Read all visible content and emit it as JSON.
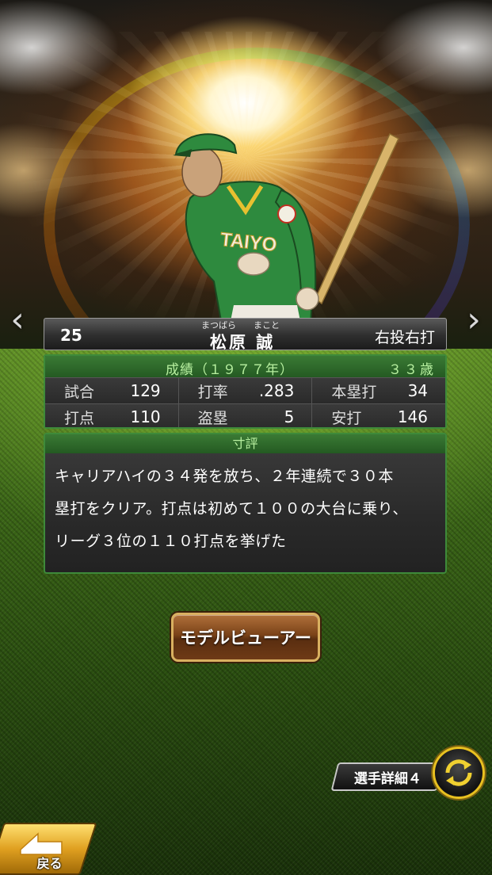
{
  "player": {
    "number": "25",
    "name": "松原 誠",
    "kana_family": "まつばら",
    "kana_given": "まこと",
    "throw_bat": "右投右打",
    "jersey_text": "TAIYO"
  },
  "stats": {
    "season_label": "成績（１９７７年）",
    "age_label": "３３歳",
    "rows": [
      [
        {
          "label": "試合",
          "value": "129"
        },
        {
          "label": "打率",
          "value": ".283"
        },
        {
          "label": "本塁打",
          "value": "34"
        }
      ],
      [
        {
          "label": "打点",
          "value": "110"
        },
        {
          "label": "盗塁",
          "value": "5"
        },
        {
          "label": "安打",
          "value": "146"
        }
      ]
    ]
  },
  "comment": {
    "title": "寸評",
    "text": "キャリアハイの３４発を放ち、２年連続で３０本\n塁打をクリア。打点は初めて１００の大台に乗り、\nリーグ３位の１１０打点を挙げた"
  },
  "buttons": {
    "model_viewer": "モデルビューアー",
    "player_detail": "選手詳細４",
    "back": "戻る",
    "prev_arrow": "‹",
    "next_arrow": "›"
  },
  "colors": {
    "panel_green": "#3e8a3a",
    "header_text_green": "#b8f0a0",
    "button_gold": "#d9b060",
    "cycle_yellow": "#e8c020"
  }
}
